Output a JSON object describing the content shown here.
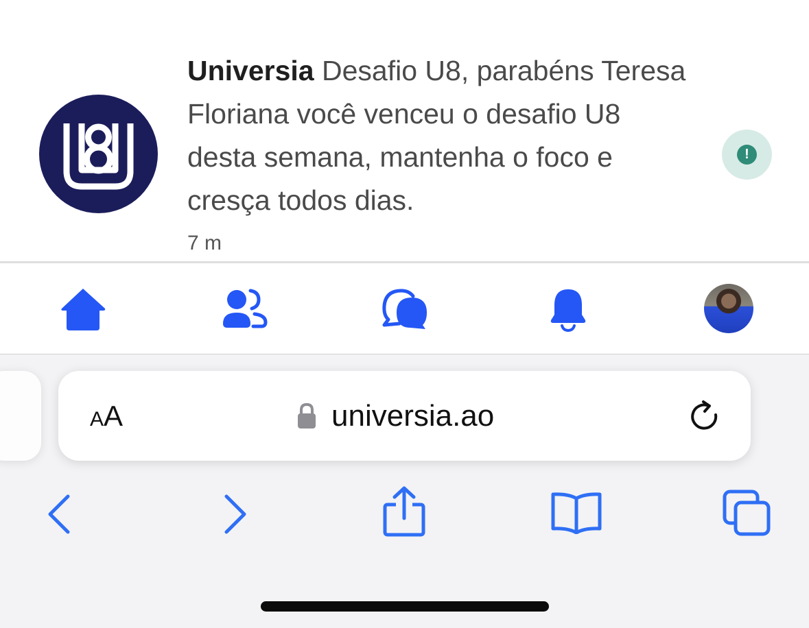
{
  "notification": {
    "source": "Universia",
    "message": "Desafio U8, parabéns Teresa Floriana você venceu o desafio U8 desta semana, mantenha o foco e cresça todos dias.",
    "time": "7 m",
    "logo_icon": "u8-logo-icon",
    "badge_icon": "exclamation-icon",
    "colors": {
      "logo_bg": "#1b1d5a",
      "badge_bg": "#d7ebe6",
      "badge_dot": "#2f8c78"
    }
  },
  "site_nav": {
    "items": [
      {
        "icon": "home-icon"
      },
      {
        "icon": "friends-icon"
      },
      {
        "icon": "chat-icon"
      },
      {
        "icon": "bell-icon"
      },
      {
        "icon": "avatar"
      }
    ],
    "accent": "#2457f5"
  },
  "browser": {
    "text_size_button": {
      "small": "A",
      "large": "A"
    },
    "url": "universia.ao",
    "lock_icon": "lock-icon",
    "reload_icon": "reload-icon",
    "toolbar": [
      {
        "icon": "back-icon"
      },
      {
        "icon": "forward-icon"
      },
      {
        "icon": "share-icon"
      },
      {
        "icon": "bookmarks-icon"
      },
      {
        "icon": "tabs-icon"
      }
    ],
    "toolbar_color": "#2f6ff5"
  }
}
